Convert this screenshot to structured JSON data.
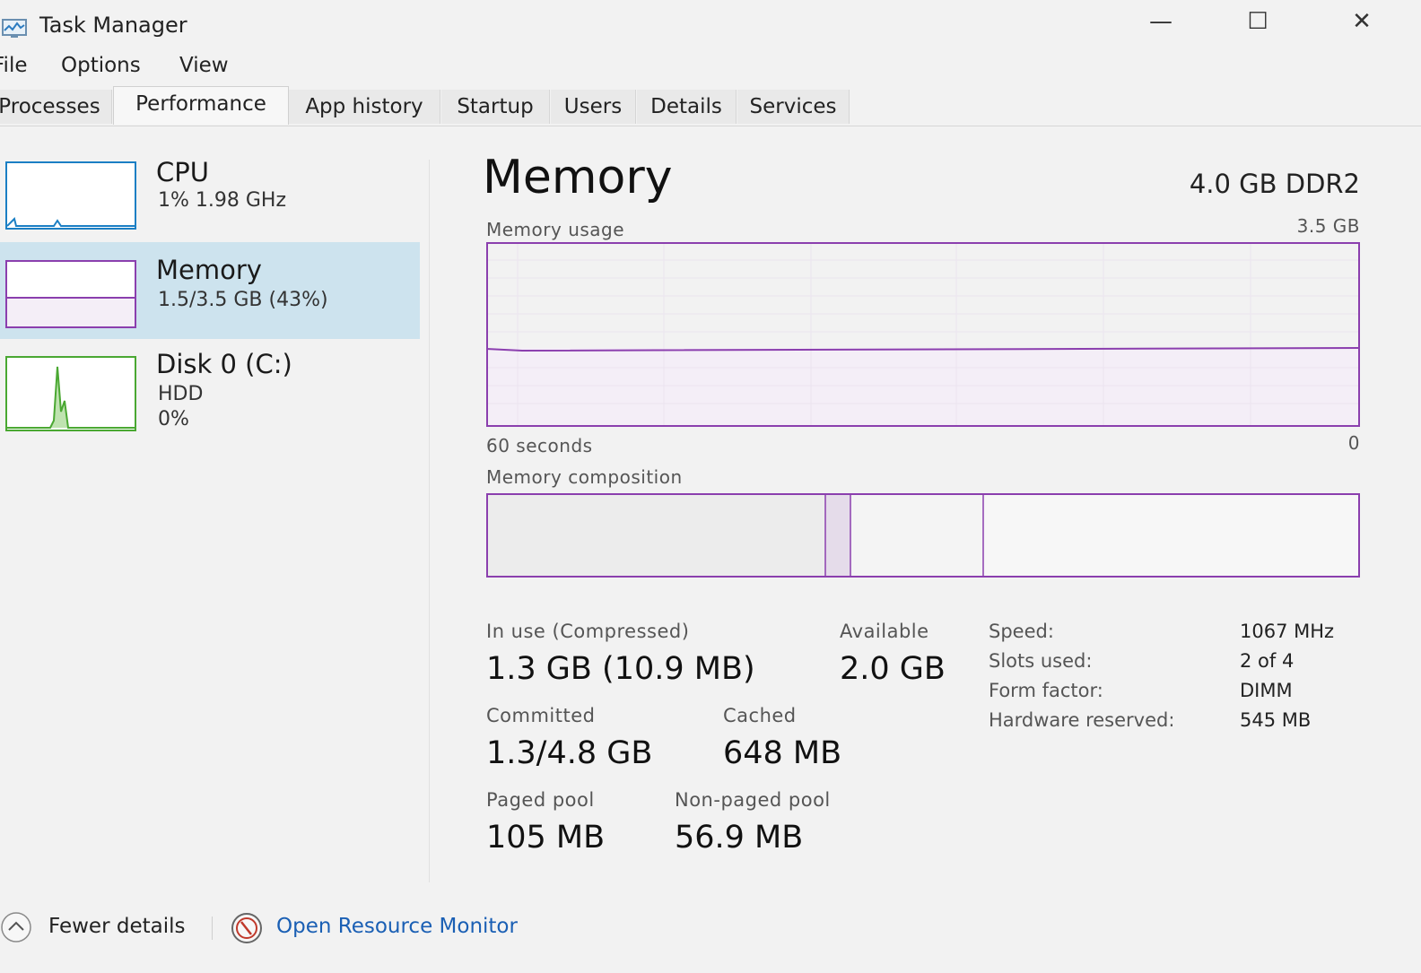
{
  "window": {
    "title": "Task Manager",
    "controls": {
      "minimize": "—",
      "maximize": "☐",
      "close": "✕"
    }
  },
  "menu": [
    {
      "label": "File"
    },
    {
      "label": "Options"
    },
    {
      "label": "View"
    }
  ],
  "tabs": [
    {
      "label": "Processes"
    },
    {
      "label": "Performance",
      "active": true
    },
    {
      "label": "App history"
    },
    {
      "label": "Startup"
    },
    {
      "label": "Users"
    },
    {
      "label": "Details"
    },
    {
      "label": "Services"
    }
  ],
  "sidebar": {
    "cpu": {
      "title": "CPU",
      "subtitle": "1%  1.98 GHz",
      "graph_color": "#1b7fc4"
    },
    "memory": {
      "title": "Memory",
      "subtitle": "1.5/3.5 GB (43%)",
      "graph_color": "#8b3fae",
      "selected": true
    },
    "disk": {
      "title": "Disk 0 (C:)",
      "subtitle": "HDD",
      "subtitle2": "0%",
      "graph_color": "#4aa832"
    }
  },
  "main": {
    "title": "Memory",
    "spec": "4.0 GB DDR2",
    "usage": {
      "label": "Memory usage",
      "max_label": "3.5 GB",
      "time_label": "60 seconds",
      "min_label": "0",
      "color": "#8b3fae",
      "fill_color": "#f4eef7"
    },
    "composition": {
      "label": "Memory composition"
    },
    "stats": {
      "in_use_label": "In use (Compressed)",
      "in_use_value": "1.3 GB (10.9 MB)",
      "available_label": "Available",
      "available_value": "2.0 GB",
      "committed_label": "Committed",
      "committed_value": "1.3/4.8 GB",
      "cached_label": "Cached",
      "cached_value": "648 MB",
      "paged_label": "Paged pool",
      "paged_value": "105 MB",
      "nonpaged_label": "Non-paged pool",
      "nonpaged_value": "56.9 MB"
    },
    "specs": {
      "speed_label": "Speed:",
      "speed_value": "1067 MHz",
      "slots_label": "Slots used:",
      "slots_value": "2 of 4",
      "form_label": "Form factor:",
      "form_value": "DIMM",
      "reserved_label": "Hardware reserved:",
      "reserved_value": "545 MB"
    }
  },
  "footer": {
    "fewer_details": "Fewer details",
    "resource_monitor": "Open Resource Monitor"
  }
}
